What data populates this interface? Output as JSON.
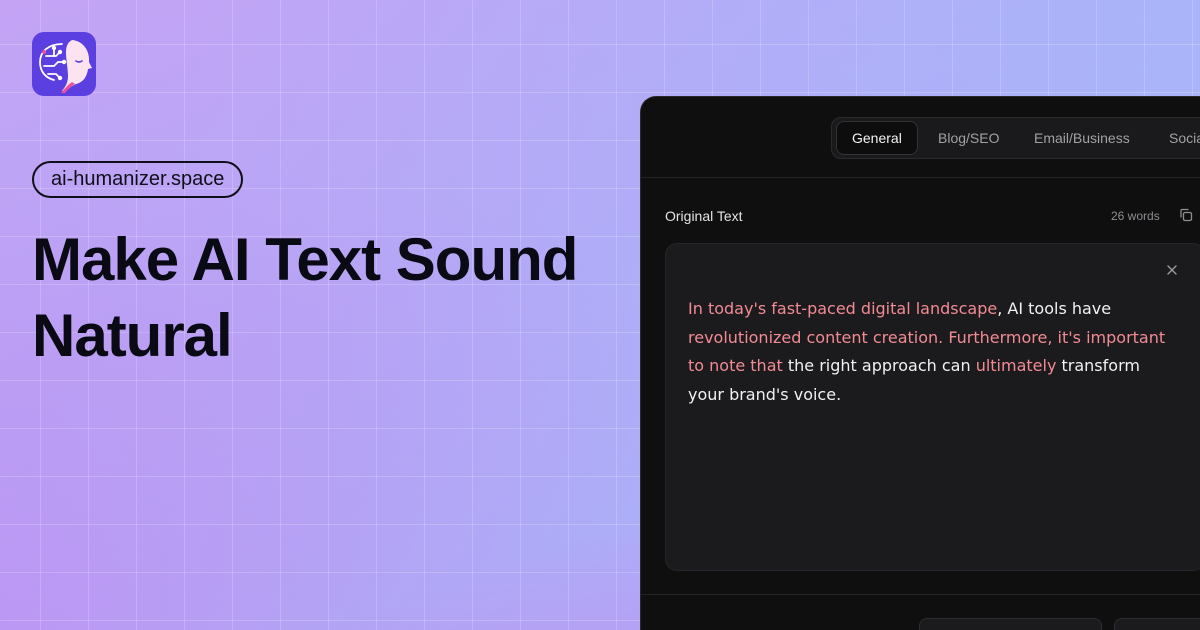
{
  "site": {
    "domain": "ai-humanizer.space",
    "headline_line1": "Make AI Text Sound",
    "headline_line2": "Natural"
  },
  "logo": {
    "icon": "face-circuit-icon",
    "background": "#5b3fe0"
  },
  "tabs": [
    {
      "label": "General",
      "active": true
    },
    {
      "label": "Blog/SEO",
      "active": false
    },
    {
      "label": "Email/Business",
      "active": false
    },
    {
      "label": "Social",
      "active": false
    }
  ],
  "editor": {
    "label": "Original Text",
    "word_count": "26 words",
    "segments": [
      {
        "text": "In today's fast-paced digital landscape",
        "ai": true
      },
      {
        "text": ", AI tools have ",
        "ai": false
      },
      {
        "text": "revolutionized content creation. Furthermore, it's important to note that",
        "ai": true
      },
      {
        "text": " the right approach can ",
        "ai": false
      },
      {
        "text": "ultimately",
        "ai": true
      },
      {
        "text": " transform your brand's voice.",
        "ai": false
      }
    ]
  },
  "colors": {
    "ai_highlight": "#f28b94",
    "panel_background": "#0f0f10",
    "active_tab_background": "#0d0d0e"
  }
}
